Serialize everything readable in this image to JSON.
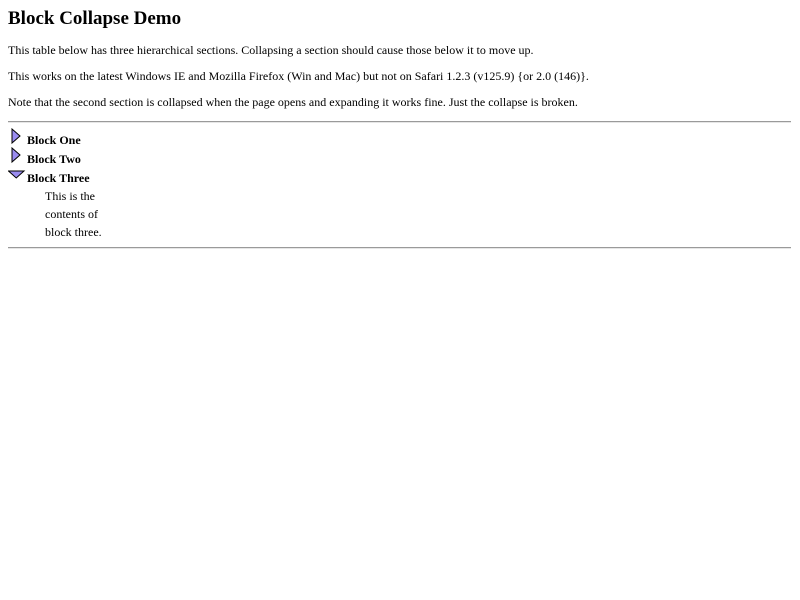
{
  "page": {
    "title": "Block Collapse Demo",
    "paragraphs": [
      "This table below has three hierarchical sections. Collapsing a section should cause those below it to move up.",
      "This works on the latest Windows IE and Mozilla Firefox (Win and Mac) but not on Safari 1.2.3 (v125.9) {or 2.0 (146)}.",
      "Note that the second section is collapsed when the page opens and expanding it works fine. Just the collapse is broken."
    ]
  },
  "blocks": [
    {
      "label": "Block One",
      "state": "collapsed",
      "icon": "triangle-right-icon"
    },
    {
      "label": "Block Two",
      "state": "collapsed",
      "icon": "triangle-right-icon"
    },
    {
      "label": "Block Three",
      "state": "expanded",
      "icon": "triangle-down-icon",
      "contents": [
        "This is the",
        "contents of",
        "block three."
      ]
    }
  ],
  "colors": {
    "triangle_fill": "#9a8cf0",
    "triangle_stroke": "#000000",
    "rule": "#9a9a9a"
  }
}
